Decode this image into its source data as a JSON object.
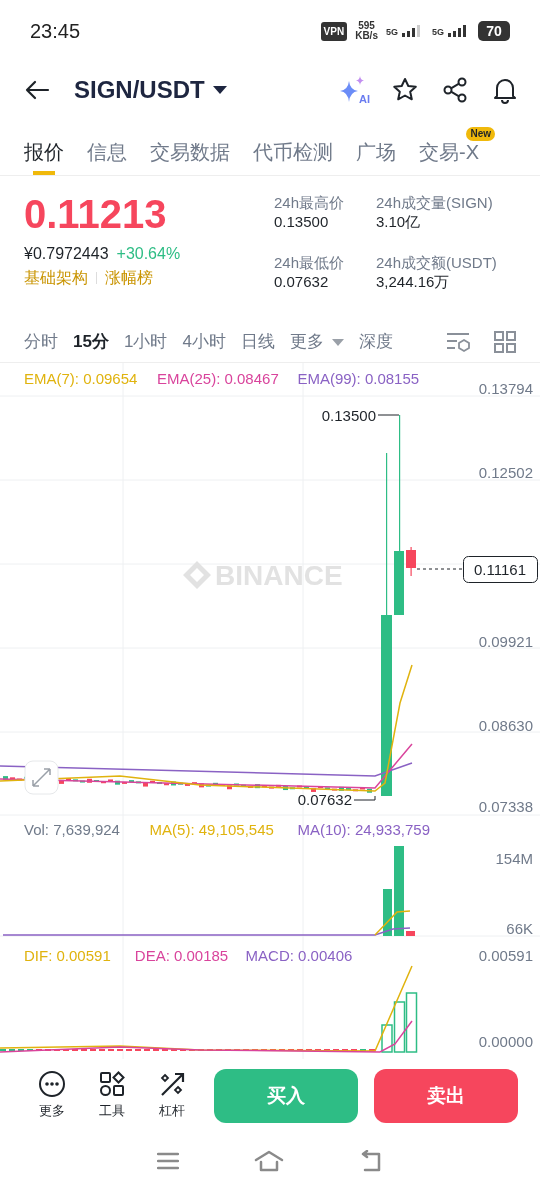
{
  "status_bar": {
    "time": "23:45",
    "vpn": "VPN",
    "speed": "595",
    "speed_unit": "KB/s",
    "network_1": "5G",
    "network_2": "5G",
    "battery": "70"
  },
  "header": {
    "title": "SIGN/USDT",
    "ai_label": "AI"
  },
  "tabs": [
    {
      "label": "报价",
      "selected": true
    },
    {
      "label": "信息",
      "selected": false
    },
    {
      "label": "交易数据",
      "selected": false
    },
    {
      "label": "代币检测",
      "selected": false
    },
    {
      "label": "广场",
      "selected": false
    },
    {
      "label": "交易-X",
      "selected": false,
      "badge": "New"
    }
  ],
  "price": {
    "last": "0.11213",
    "cny": "¥0.7972443",
    "change": "+30.64%",
    "tags": [
      "基础架构",
      "涨幅榜"
    ]
  },
  "stats": [
    {
      "label": "24h最高价",
      "value": "0.13500"
    },
    {
      "label": "24h成交量(SIGN)",
      "value": "3.10亿"
    },
    {
      "label": "24h最低价",
      "value": "0.07632"
    },
    {
      "label": "24h成交额(USDT)",
      "value": "3,244.16万"
    }
  ],
  "intervals": [
    {
      "label": "分时",
      "selected": false
    },
    {
      "label": "15分",
      "selected": true
    },
    {
      "label": "1小时",
      "selected": false
    },
    {
      "label": "4小时",
      "selected": false
    },
    {
      "label": "日线",
      "selected": false
    },
    {
      "label": "更多",
      "selected": false,
      "dropdown": true
    },
    {
      "label": "深度",
      "selected": false
    }
  ],
  "price_chart": {
    "legend": [
      {
        "text": "EMA(7): 0.09654",
        "color": "#e0b30e"
      },
      {
        "text": "EMA(25): 0.08467",
        "color": "#d9449c"
      },
      {
        "text": "EMA(99): 0.08155",
        "color": "#8a62c4"
      }
    ],
    "axis_labels": [
      "0.13794",
      "0.12502",
      "0.09921",
      "0.08630",
      "0.07338"
    ],
    "high_label": "0.13500",
    "low_label": "0.07632",
    "last_price": "0.11161",
    "watermark": "BINANCE"
  },
  "volume_chart": {
    "legend": [
      {
        "text": "Vol: 7,639,924",
        "color": "#707a8a"
      },
      {
        "text": "MA(5): 49,105,545",
        "color": "#e0b30e"
      },
      {
        "text": "MA(10): 24,933,759",
        "color": "#8a62c4"
      }
    ],
    "axis_labels": [
      "154M",
      "66K"
    ]
  },
  "macd_chart": {
    "legend": [
      {
        "text": "DIF: 0.00591",
        "color": "#e0b30e"
      },
      {
        "text": "DEA: 0.00185",
        "color": "#d9449c"
      },
      {
        "text": "MACD: 0.00406",
        "color": "#8a62c4"
      }
    ],
    "axis_labels": [
      "0.00591",
      "0.00000"
    ]
  },
  "toolbar": [
    {
      "label": "更多",
      "kind": "more"
    },
    {
      "label": "工具",
      "kind": "tools"
    },
    {
      "label": "杠杆",
      "kind": "leverage"
    }
  ],
  "actions": [
    {
      "label": "买入",
      "kind": "buy"
    },
    {
      "label": "卖出",
      "kind": "sell"
    }
  ]
}
